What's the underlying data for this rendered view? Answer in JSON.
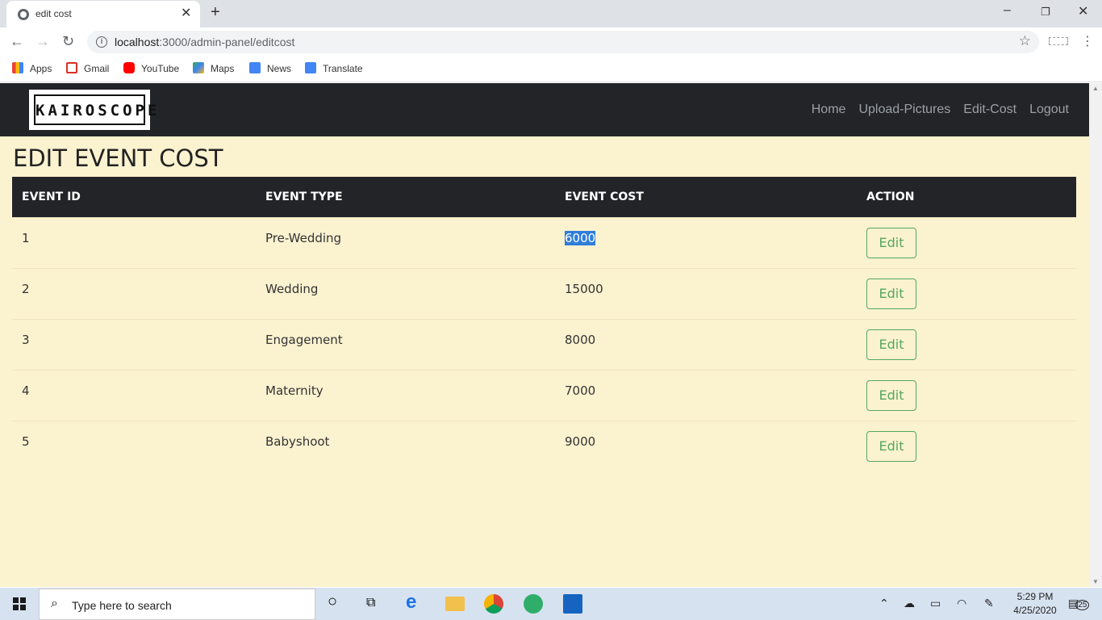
{
  "browser": {
    "tab_title": "edit cost",
    "url_host": "localhost",
    "url_rest": ":3000/admin-panel/editcost",
    "bookmarks": [
      "Apps",
      "Gmail",
      "YouTube",
      "Maps",
      "News",
      "Translate"
    ]
  },
  "navbar": {
    "logo": "KAIROSCOPE",
    "links": [
      "Home",
      "Upload-Pictures",
      "Edit-Cost",
      "Logout"
    ]
  },
  "page_title": "EDIT EVENT COST",
  "table": {
    "headers": [
      "EVENT ID",
      "EVENT TYPE",
      "EVENT COST",
      "ACTION"
    ],
    "rows": [
      {
        "id": "1",
        "type": "Pre-Wedding",
        "cost": "6000",
        "action": "Edit"
      },
      {
        "id": "2",
        "type": "Wedding",
        "cost": "15000",
        "action": "Edit"
      },
      {
        "id": "3",
        "type": "Engagement",
        "cost": "8000",
        "action": "Edit"
      },
      {
        "id": "4",
        "type": "Maternity",
        "cost": "7000",
        "action": "Edit"
      },
      {
        "id": "5",
        "type": "Babyshoot",
        "cost": "9000",
        "action": "Edit"
      }
    ]
  },
  "taskbar": {
    "search_placeholder": "Type here to search",
    "time": "5:29 PM",
    "date": "4/25/2020",
    "notification_count": "25"
  },
  "colors": {
    "page_bg": "#fbf2d0",
    "navbar_bg": "#222428",
    "edit_green": "#54a85d",
    "selection_blue": "#2f7ed8"
  }
}
